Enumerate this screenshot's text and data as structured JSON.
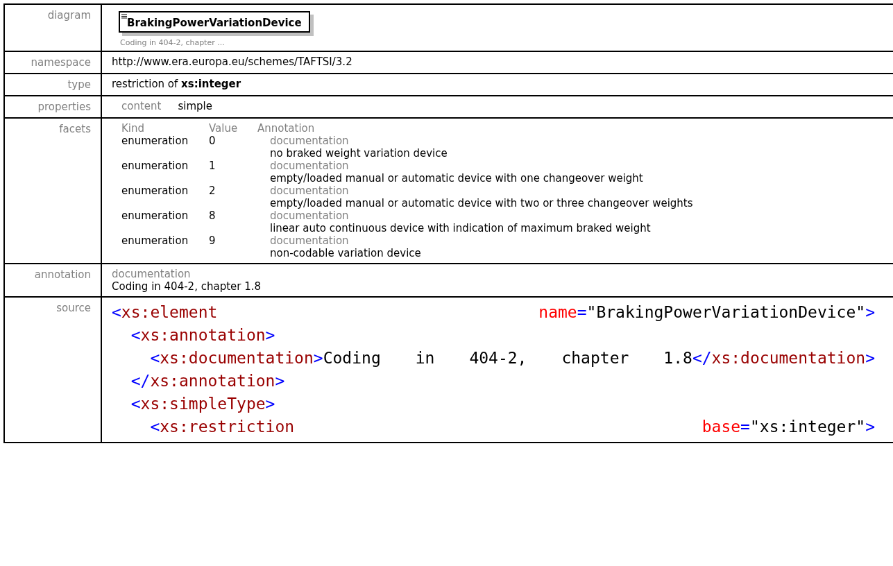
{
  "diagram": {
    "label": "diagram",
    "element_name": "BrakingPowerVariationDevice",
    "caption": "Coding in 404-2, chapter ..."
  },
  "namespace": {
    "label": "namespace",
    "value": "http://www.era.europa.eu/schemes/TAFTSI/3.2"
  },
  "type": {
    "label": "type",
    "prefix": "restriction of",
    "base": "xs:integer"
  },
  "properties": {
    "label": "properties",
    "key": "content",
    "value": "simple"
  },
  "facets": {
    "label": "facets",
    "columns": [
      "Kind",
      "Value",
      "Annotation"
    ],
    "rows": [
      {
        "kind": "enumeration",
        "value": "0",
        "doc_label": "documentation",
        "doc": "no braked weight variation device"
      },
      {
        "kind": "enumeration",
        "value": "1",
        "doc_label": "documentation",
        "doc": "empty/loaded manual or automatic device with one changeover weight"
      },
      {
        "kind": "enumeration",
        "value": "2",
        "doc_label": "documentation",
        "doc": "empty/loaded manual or automatic device with two or three changeover weights"
      },
      {
        "kind": "enumeration",
        "value": "8",
        "doc_label": "documentation",
        "doc": "linear auto continuous device with indication of maximum braked weight"
      },
      {
        "kind": "enumeration",
        "value": "9",
        "doc_label": "documentation",
        "doc": "non-codable variation device"
      }
    ]
  },
  "annotation": {
    "label": "annotation",
    "doc_label": "documentation",
    "doc": "Coding in 404-2, chapter 1.8"
  },
  "source": {
    "label": "source",
    "lines": [
      [
        {
          "kind": "punct",
          "text": "<"
        },
        {
          "kind": "tag",
          "text": "xs:element "
        },
        {
          "kind": "attr",
          "text": "name"
        },
        {
          "kind": "punct",
          "text": "="
        },
        {
          "kind": "value",
          "text": "\"BrakingPowerVariationDevice\""
        },
        {
          "kind": "punct",
          "text": ">"
        }
      ],
      [
        {
          "kind": "punct",
          "text": "  <"
        },
        {
          "kind": "tag",
          "text": "xs:annotation"
        },
        {
          "kind": "punct",
          "text": ">"
        }
      ],
      [
        {
          "kind": "punct",
          "text": "    <"
        },
        {
          "kind": "tag",
          "text": "xs:documentation"
        },
        {
          "kind": "punct",
          "text": ">"
        },
        {
          "kind": "text",
          "text": "Coding in 404-2, chapter 1.8"
        },
        {
          "kind": "punct",
          "text": "</"
        },
        {
          "kind": "tag",
          "text": "xs:documentation"
        },
        {
          "kind": "punct",
          "text": ">"
        }
      ],
      [
        {
          "kind": "punct",
          "text": "  </"
        },
        {
          "kind": "tag",
          "text": "xs:annotation"
        },
        {
          "kind": "punct",
          "text": ">"
        }
      ],
      [
        {
          "kind": "punct",
          "text": "  <"
        },
        {
          "kind": "tag",
          "text": "xs:simpleType"
        },
        {
          "kind": "punct",
          "text": ">"
        }
      ],
      [
        {
          "kind": "punct",
          "text": "    <"
        },
        {
          "kind": "tag",
          "text": "xs:restriction "
        },
        {
          "kind": "attr",
          "text": "base"
        },
        {
          "kind": "punct",
          "text": "="
        },
        {
          "kind": "value",
          "text": "\"xs:integer\""
        },
        {
          "kind": "punct",
          "text": ">"
        }
      ]
    ]
  }
}
